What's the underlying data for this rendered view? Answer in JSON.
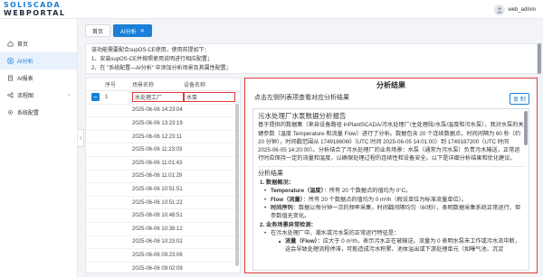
{
  "brand": {
    "line1": "SOLISCADA",
    "line2": "WEBPORTAL"
  },
  "user": {
    "name": "web_admin"
  },
  "sidebar": {
    "items": [
      {
        "label": "首页",
        "icon": "home-icon"
      },
      {
        "label": "AI分析",
        "icon": "ai-icon"
      },
      {
        "label": "AI报表",
        "icon": "report-icon"
      },
      {
        "label": "流程图",
        "icon": "flow-icon"
      },
      {
        "label": "系统配置",
        "icon": "gear-icon"
      }
    ],
    "active_index": 1
  },
  "tabs": [
    {
      "label": "首页"
    },
    {
      "label": "AI分析"
    }
  ],
  "notice": {
    "line1": "该功能需要配合supOS-CE使用，使用前提如下：",
    "line2": "1、安装supOS-CE并按照使用说明进行相应配置；",
    "line3": "2、在 \"系统配置—AI分析\" 中添加分析场景及其属性配置；"
  },
  "table": {
    "headers": [
      "序号",
      "场景名称",
      "设备名称"
    ],
    "selected_row": {
      "index": "1",
      "scene": "水处理工厂",
      "device": "水泵"
    },
    "timestamps": [
      "2025-06-06 14:23:04",
      "2025-06-06 13:23:19",
      "2025-06-06 12:23:11",
      "2025-06-06 11:23:03",
      "2025-06-06 11:01:43",
      "2025-06-06 11:01:29",
      "2025-06-06 10:51:51",
      "2025-06-06 10:51:22",
      "2025-06-06 10:48:51",
      "2025-06-06 10:38:12",
      "2025-06-06 10:23:02",
      "2025-06-06 09:23:06",
      "2025-06-06 09:02:09"
    ]
  },
  "result": {
    "title": "分析结果",
    "hint": "点击左侧列表项查看对应分析结果",
    "copy_label": "复 制",
    "report_title": "污水处理厂水泵数据分析报告",
    "intro": "基于提供的数据集（来自设备路径 InPlantSCADA/污水处理厂/主处理段/水泵/温度和污水泵），我对水泵的关键参数（温度 Temperature 和流量 Flow）进行了分析。数据包含 20 个连续数据点，时间间隔为 60 秒（约 20 分钟），时间戳范围从 1749186060（UTC 时间 2025-06-05 14:01:00）到 1749187200（UTC 时间 2025-06-05 14:20:00）。分析结合了污水处理厂的业务场景：水泵（通常为污水泵）负责污水输送，正常运行时应保持一定的流量和温度，以确保处理过程的连续性和设备安全。以下是详细分析结果和优化建议。",
    "section1": "分析结果",
    "sub1": "1. 数据概况：",
    "b_temp_label": "Temperature（温度）",
    "b_temp_text": "：所有 20 个数据点的值均为 0°C。",
    "b_flow_label": "Flow（流量）",
    "b_flow_text": "：所有 20 个数据点的值均为 0 m³/h（假设单位为标准流量单位）。",
    "b_time_label": "时间序列",
    "b_time_text": "：数据以每分钟一次的频率采集，时间戳间隔均匀（60秒），表明数据采集系统正常运行，但参数值无变化。",
    "sub2": "2. 业务场景异常检测：",
    "b_plant": "在污水处理厂中，潮水或污水泵的正常运行特征是：",
    "b_flow2_label": "流量（Flow）",
    "b_flow2_text": "：应大于 0 m³/h，表示污水正在被输送。流量为 0 表明水泵未工作或污水流中断，这会导致处理流程停滞，可能造成污水积累、池体溢出或下游处理单元（如曝气池、沉淀"
  }
}
